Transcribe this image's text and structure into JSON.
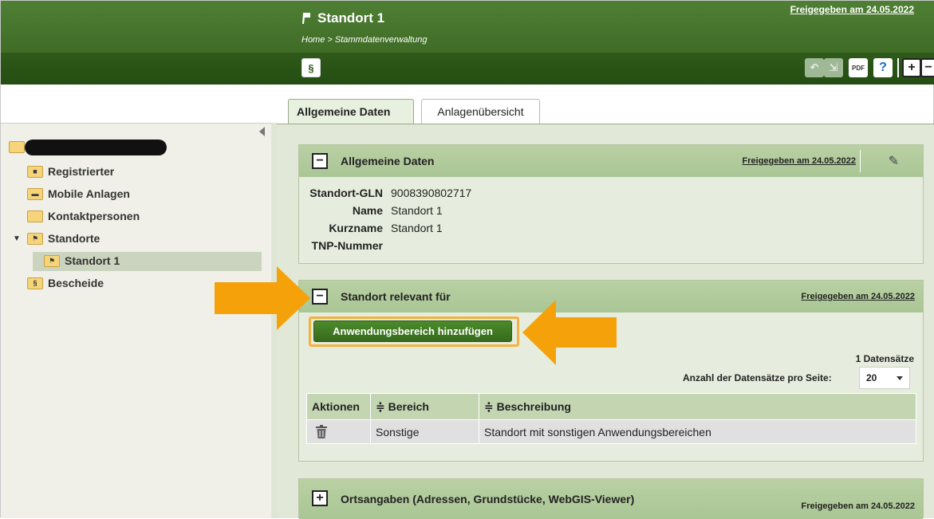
{
  "header": {
    "title": "Standort 1",
    "breadcrumb": "Home > Stammdatenverwaltung",
    "released": "Freigegeben am 24.05.2022"
  },
  "toolbar": {
    "paragraph_icon": "§",
    "undo_icon": "↶",
    "export_icon": "⇲",
    "pdf_icon": "PDF",
    "help_icon": "?",
    "expand_icon": "+",
    "collapse_icon": "−"
  },
  "sidebar": {
    "items": [
      {
        "label": "Registrierter",
        "icon": "person-folder-icon"
      },
      {
        "label": "Mobile Anlagen",
        "icon": "truck-folder-icon"
      },
      {
        "label": "Kontaktpersonen",
        "icon": "folder-icon"
      },
      {
        "label": "Standorte",
        "icon": "pin-folder-icon"
      },
      {
        "label": "Standort 1",
        "icon": "pin-folder-icon"
      },
      {
        "label": "Bescheide",
        "icon": "paragraph-folder-icon"
      }
    ]
  },
  "tabs": [
    {
      "label": "Allgemeine Daten",
      "active": true
    },
    {
      "label": "Anlagenübersicht",
      "active": false
    }
  ],
  "general": {
    "title": "Allgemeine Daten",
    "released": "Freigegeben am 24.05.2022",
    "fields": [
      {
        "key": "Standort-GLN",
        "value": "9008390802717"
      },
      {
        "key": "Name",
        "value": "Standort 1"
      },
      {
        "key": "Kurzname",
        "value": "Standort 1"
      },
      {
        "key": "TNP-Nummer",
        "value": ""
      }
    ]
  },
  "relevance": {
    "title": "Standort relevant für",
    "released": "Freigegeben am 24.05.2022",
    "add_button": "Anwendungsbereich hinzufügen",
    "records": "1 Datensätze",
    "per_page_label": "Anzahl der Datensätze pro Seite:",
    "per_page_value": "20",
    "columns": [
      "Aktionen",
      "≑ Bereich",
      "≑ Beschreibung"
    ],
    "rows": [
      {
        "bereich": "Sonstige",
        "beschreibung": "Standort mit sonstigen Anwendungsbereichen"
      }
    ]
  },
  "location": {
    "title": "Ortsangaben (Adressen, Grundstücke, WebGIS-Viewer)",
    "released": "Freigegeben am 24.05.2022"
  },
  "colors": {
    "header_green": "#3f6c26",
    "panel_green": "#b9d0a3",
    "accent_orange": "#f5a20a"
  }
}
